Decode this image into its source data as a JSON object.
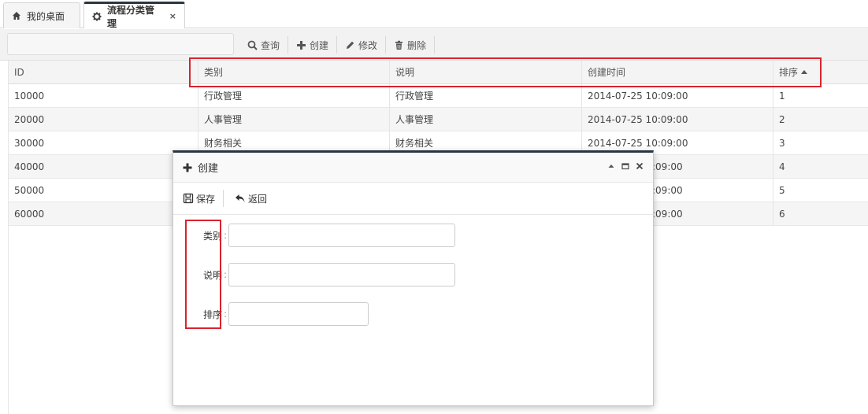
{
  "tabs": [
    {
      "label": "我的桌面",
      "icon": "home-icon",
      "active": false
    },
    {
      "label": "流程分类管理",
      "icon": "gear-icon",
      "active": true,
      "close": "×"
    }
  ],
  "toolbar": {
    "search_placeholder": "",
    "buttons": [
      {
        "label": "查询",
        "icon": "search-icon"
      },
      {
        "label": "创建",
        "icon": "plus-icon"
      },
      {
        "label": "修改",
        "icon": "pencil-icon"
      },
      {
        "label": "删除",
        "icon": "trash-icon"
      }
    ]
  },
  "grid": {
    "columns": [
      "ID",
      "类别",
      "说明",
      "创建时间",
      "排序"
    ],
    "sort_column": "排序",
    "rows": [
      [
        "10000",
        "行政管理",
        "行政管理",
        "2014-07-25 10:09:00",
        "1"
      ],
      [
        "20000",
        "人事管理",
        "人事管理",
        "2014-07-25 10:09:00",
        "2"
      ],
      [
        "30000",
        "财务相关",
        "财务相关",
        "2014-07-25 10:09:00",
        "3"
      ],
      [
        "40000",
        "",
        "",
        ":09:00",
        "4"
      ],
      [
        "50000",
        "",
        "",
        ":09:00",
        "5"
      ],
      [
        "60000",
        "",
        "",
        ":09:00",
        "6"
      ]
    ]
  },
  "modal": {
    "title": "创建",
    "title_icon": "plus-icon",
    "tools": [
      {
        "label": "保存",
        "icon": "save-icon"
      },
      {
        "label": "返回",
        "icon": "back-icon"
      }
    ],
    "fields": [
      {
        "label": "类别",
        "value": ""
      },
      {
        "label": "说明",
        "value": ""
      },
      {
        "label": "排序",
        "value": ""
      }
    ],
    "label_colon": ":"
  },
  "colors": {
    "highlight": "#d9232d",
    "accent_dark": "#2b3640"
  }
}
